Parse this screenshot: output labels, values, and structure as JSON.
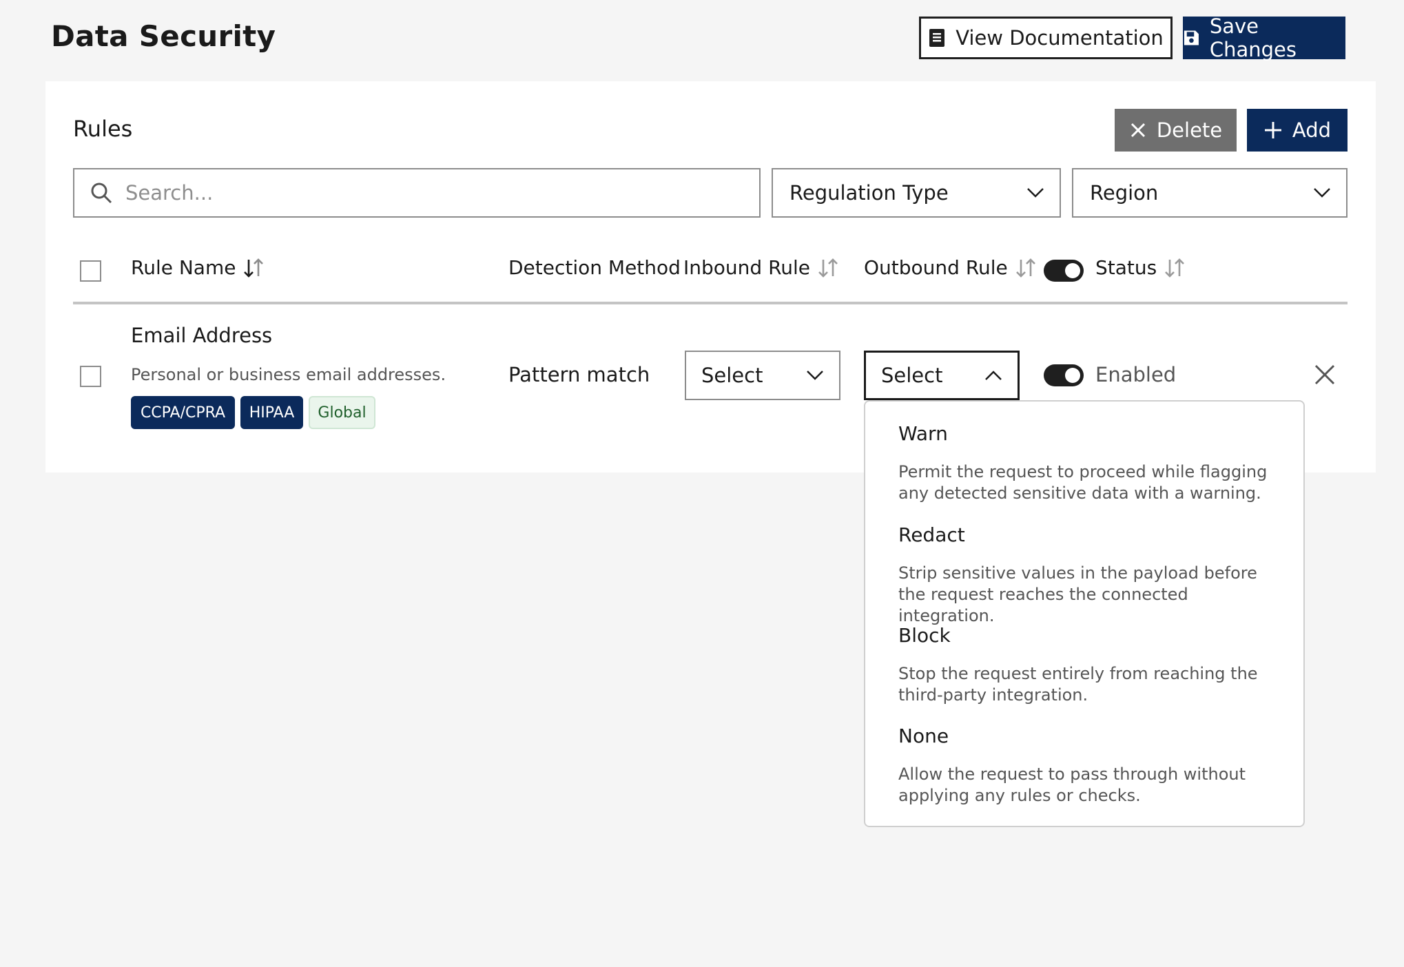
{
  "page": {
    "title": "Data Security",
    "view_docs_label": "View Documentation",
    "save_label": "Save Changes"
  },
  "rules": {
    "title": "Rules",
    "delete_label": "Delete",
    "add_label": "Add",
    "search_placeholder": "Search...",
    "filters": {
      "regulation_type": "Regulation Type",
      "region": "Region"
    },
    "columns": {
      "rule_name": "Rule Name",
      "detection_method": "Detection Method",
      "inbound_rule": "Inbound Rule",
      "outbound_rule": "Outbound Rule",
      "status": "Status"
    },
    "rows": [
      {
        "name": "Email Address",
        "description": "Personal or business email addresses.",
        "tags": [
          "CCPA/CPRA",
          "HIPAA",
          "Global"
        ],
        "detection_method": "Pattern match",
        "inbound_value": "Select",
        "outbound_value": "Select",
        "status": "Enabled"
      }
    ]
  },
  "outbound_dropdown": {
    "options": [
      {
        "label": "Warn",
        "description": "Permit the request to proceed while flagging any detected sensitive data with a warning."
      },
      {
        "label": "Redact",
        "description": "Strip sensitive values in the payload before the request reaches the connected integration."
      },
      {
        "label": "Block",
        "description": "Stop the request entirely from reaching the third-party integration."
      },
      {
        "label": "None",
        "description": "Allow the request to pass through without applying any rules or checks."
      }
    ]
  },
  "colors": {
    "navy": "#0b2a5b",
    "delete_gray": "#6f6f6f",
    "tag_green_bg": "#eaf5ec"
  }
}
